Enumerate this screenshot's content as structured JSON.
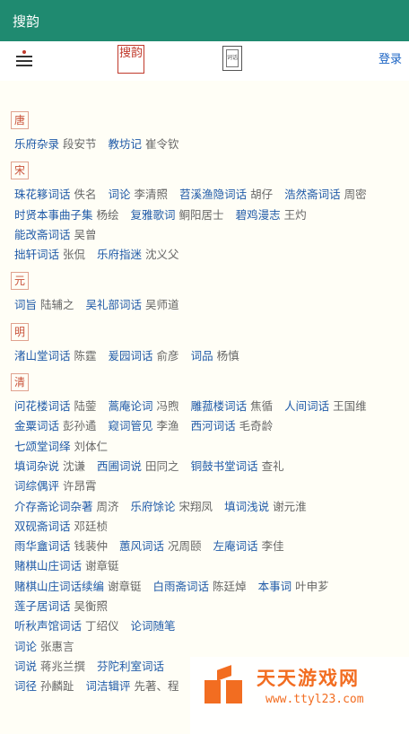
{
  "app": {
    "title": "搜韵"
  },
  "toolbar": {
    "seal_text": "搜韵",
    "book_text": "词话",
    "login": "登录"
  },
  "sections": [
    {
      "dynasty": "唐",
      "rows": [
        [
          {
            "title": "乐府杂录",
            "author": "段安节"
          },
          {
            "title": "教坊记",
            "author": "崔令钦"
          }
        ]
      ]
    },
    {
      "dynasty": "宋",
      "rows": [
        [
          {
            "title": "珠花簃词话",
            "author": "佚名"
          },
          {
            "title": "词论",
            "author": "李清照"
          },
          {
            "title": "苕溪渔隐词话",
            "author": "胡仔"
          },
          {
            "title": "浩然斋词话",
            "author": "周密"
          }
        ],
        [
          {
            "title": "时贤本事曲子集",
            "author": "杨绘"
          },
          {
            "title": "复雅歌词",
            "author": "鲖阳居士"
          },
          {
            "title": "碧鸡漫志",
            "author": "王灼"
          }
        ],
        [
          {
            "title": "能改斋词话",
            "author": "吴曾"
          }
        ],
        [
          {
            "title": "拙轩词话",
            "author": "张侃"
          },
          {
            "title": "乐府指迷",
            "author": "沈义父"
          }
        ]
      ]
    },
    {
      "dynasty": "元",
      "rows": [
        [
          {
            "title": "词旨",
            "author": "陆辅之"
          },
          {
            "title": "吴礼部词话",
            "author": "吴师道"
          }
        ]
      ]
    },
    {
      "dynasty": "明",
      "rows": [
        [
          {
            "title": "渚山堂词话",
            "author": "陈霆"
          },
          {
            "title": "爰园词话",
            "author": "俞彦"
          },
          {
            "title": "词品",
            "author": "杨慎"
          }
        ]
      ]
    },
    {
      "dynasty": "清",
      "rows": [
        [
          {
            "title": "问花楼词话",
            "author": "陆蓥"
          },
          {
            "title": "蒿庵论词",
            "author": "冯煦"
          },
          {
            "title": "雕菰楼词话",
            "author": "焦循"
          },
          {
            "title": "人间词话",
            "author": "王国维"
          }
        ],
        [
          {
            "title": "金粟词话",
            "author": "彭孙遹"
          },
          {
            "title": "窥词管见",
            "author": "李渔"
          },
          {
            "title": "西河词话",
            "author": "毛奇龄"
          }
        ],
        [
          {
            "title": "七颂堂词绎",
            "author": "刘体仁"
          }
        ],
        [
          {
            "title": "填词杂说",
            "author": "沈谦"
          },
          {
            "title": "西圃词说",
            "author": "田同之"
          },
          {
            "title": "铜鼓书堂词话",
            "author": "查礼"
          }
        ],
        [
          {
            "title": "词综偶评",
            "author": "许昂霄"
          }
        ],
        [
          {
            "title": "介存斋论词杂著",
            "author": "周济"
          },
          {
            "title": "乐府馀论",
            "author": "宋翔凤"
          },
          {
            "title": "填词浅说",
            "author": "谢元淮"
          }
        ],
        [
          {
            "title": "双砚斋词话",
            "author": "邓廷桢"
          }
        ],
        [
          {
            "title": "雨华盦词话",
            "author": "钱裴仲"
          },
          {
            "title": "蕙风词话",
            "author": "况周颐"
          },
          {
            "title": "左庵词话",
            "author": "李佳"
          }
        ],
        [
          {
            "title": "赌棋山庄词话",
            "author": "谢章铤"
          }
        ],
        [
          {
            "title": "赌棋山庄词话续编",
            "author": "谢章铤"
          },
          {
            "title": "白雨斋词话",
            "author": "陈廷焯"
          },
          {
            "title": "本事词",
            "author": "叶申芗"
          }
        ],
        [
          {
            "title": "莲子居词话",
            "author": "吴衡照"
          }
        ],
        [
          {
            "title": "听秋声馆词话",
            "author": "丁绍仪"
          },
          {
            "title": "论词随笔",
            "author": ""
          }
        ],
        [
          {
            "title": "词论",
            "author": "张惠言"
          }
        ],
        [
          {
            "title": "词说",
            "author": "蒋兆兰撰"
          },
          {
            "title": "芬陀利室词话",
            "author": ""
          }
        ],
        [
          {
            "title": "词径",
            "author": "孙麟趾"
          },
          {
            "title": "词洁辑评",
            "author": "先著、程"
          }
        ]
      ]
    }
  ],
  "watermark": {
    "title": "天天游戏网",
    "url": "www.ttyl23.com"
  },
  "colors": {
    "appbar": "#1f8a70",
    "title_link": "#1f5aa8",
    "dynasty": "#c9513a",
    "watermark": "#f26d21"
  },
  "icons": {
    "menu": "menu-icon",
    "seal": "seal-logo",
    "book": "book-icon",
    "watermark_logo": "watermark-logo-icon"
  }
}
